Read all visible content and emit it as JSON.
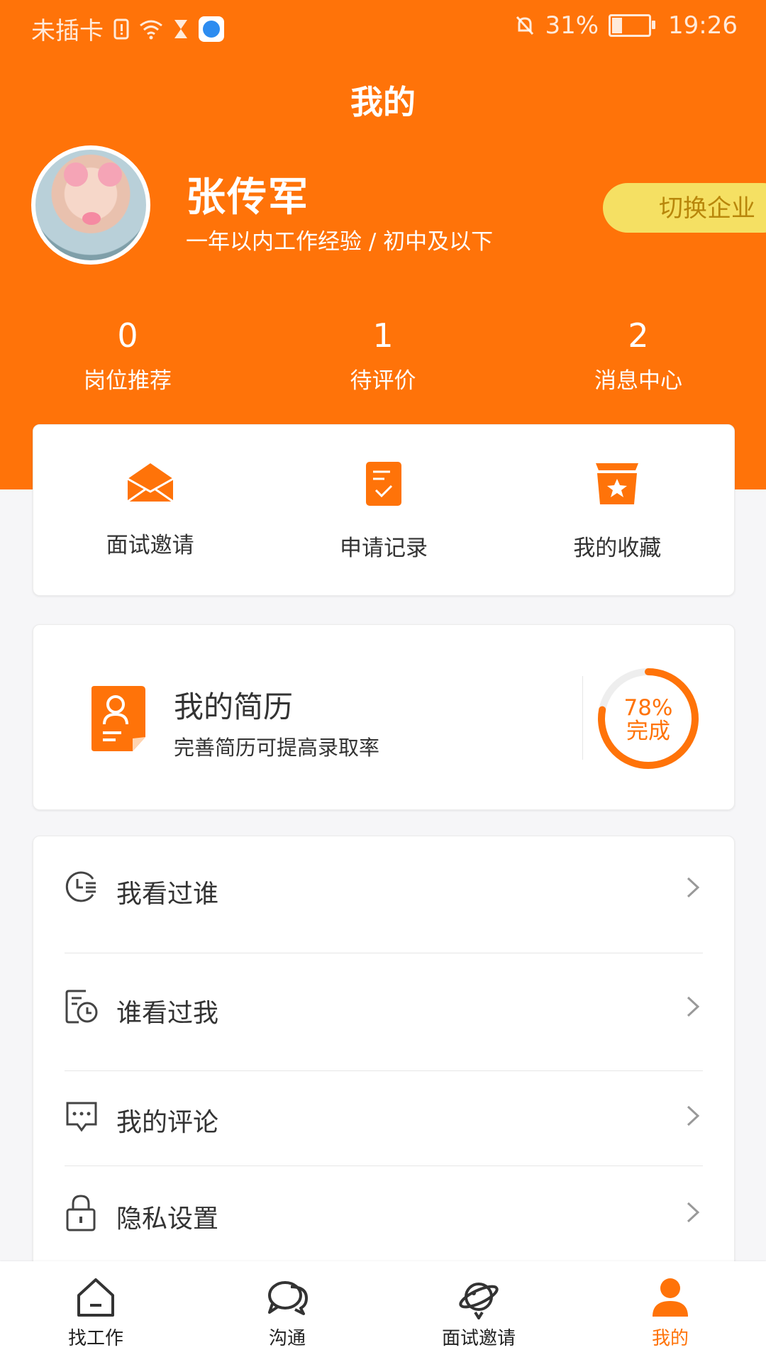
{
  "status_bar": {
    "carrier": "未插卡",
    "battery": "31%",
    "time": "19:26"
  },
  "header": {
    "title": "我的"
  },
  "profile": {
    "name": "张传军",
    "subtitle": "一年以内工作经验 / 初中及以下",
    "switch_label": "切换企业"
  },
  "stats": [
    {
      "value": "0",
      "label": "岗位推荐"
    },
    {
      "value": "1",
      "label": "待评价"
    },
    {
      "value": "2",
      "label": "消息中心"
    }
  ],
  "quick_actions": [
    {
      "label": "面试邀请",
      "icon": "envelope-icon"
    },
    {
      "label": "申请记录",
      "icon": "document-check-icon"
    },
    {
      "label": "我的收藏",
      "icon": "star-box-icon"
    }
  ],
  "resume": {
    "title": "我的简历",
    "subtitle": "完善简历可提高录取率",
    "progress_percent": 78,
    "progress_text": "78%",
    "progress_caption": "完成"
  },
  "menu": [
    {
      "label": "我看过谁",
      "icon": "clock-list-icon"
    },
    {
      "label": "谁看过我",
      "icon": "calendar-clock-icon"
    },
    {
      "label": "我的评论",
      "icon": "comment-icon"
    },
    {
      "label": "隐私设置",
      "icon": "lock-icon"
    }
  ],
  "tabs": [
    {
      "label": "找工作",
      "icon": "home-icon"
    },
    {
      "label": "沟通",
      "icon": "chat-icon"
    },
    {
      "label": "面试邀请",
      "icon": "planet-icon"
    },
    {
      "label": "我的",
      "icon": "person-icon",
      "active": true
    }
  ],
  "colors": {
    "accent": "#ff7309",
    "switch_bg": "#f5e063",
    "switch_text": "#b8860b"
  }
}
